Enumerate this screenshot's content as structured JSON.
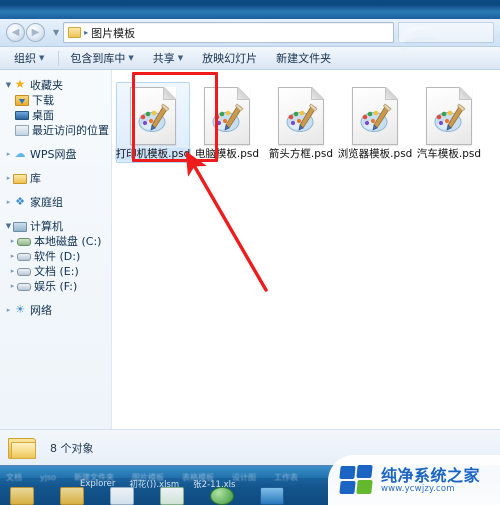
{
  "window": {
    "address": {
      "back_icon": "back-arrow-icon",
      "forward_icon": "forward-arrow-icon",
      "recent_icon": "chevron-down-icon",
      "folder_icon": "folder-icon",
      "separator": "▸",
      "crumb": "图片模板",
      "search_placeholder": ""
    },
    "toolbar": {
      "items": [
        {
          "label": "组织",
          "caret": "▼"
        },
        {
          "label": "包含到库中",
          "caret": "▼"
        },
        {
          "label": "共享",
          "caret": "▼"
        },
        {
          "label": "放映幻灯片",
          "caret": ""
        },
        {
          "label": "新建文件夹",
          "caret": ""
        }
      ]
    },
    "navigation": {
      "items": [
        {
          "label": "收藏夹",
          "icon": "star-icon",
          "twisty": "▼",
          "level": 0,
          "spaced": false
        },
        {
          "label": "下载",
          "icon": "downloads-icon",
          "twisty": "",
          "level": 1,
          "spaced": false
        },
        {
          "label": "桌面",
          "icon": "desktop-icon",
          "twisty": "",
          "level": 1,
          "spaced": false
        },
        {
          "label": "最近访问的位置",
          "icon": "recent-places-icon",
          "twisty": "",
          "level": 1,
          "spaced": false
        },
        {
          "label": "WPS网盘",
          "icon": "cloud-icon",
          "twisty": "▸",
          "level": 0,
          "spaced": true
        },
        {
          "label": "库",
          "icon": "library-icon",
          "twisty": "▸",
          "level": 0,
          "spaced": true
        },
        {
          "label": "家庭组",
          "icon": "homegroup-icon",
          "twisty": "▸",
          "level": 0,
          "spaced": true
        },
        {
          "label": "计算机",
          "icon": "computer-icon",
          "twisty": "▼",
          "level": 0,
          "spaced": true
        },
        {
          "label": "本地磁盘 (C:)",
          "icon": "system-drive-icon",
          "twisty": "▸",
          "level": 1,
          "spaced": false
        },
        {
          "label": "软件 (D:)",
          "icon": "drive-icon",
          "twisty": "▸",
          "level": 1,
          "spaced": false
        },
        {
          "label": "文档 (E:)",
          "icon": "drive-icon",
          "twisty": "▸",
          "level": 1,
          "spaced": false
        },
        {
          "label": "娱乐 (F:)",
          "icon": "drive-icon",
          "twisty": "▸",
          "level": 1,
          "spaced": false
        },
        {
          "label": "网络",
          "icon": "network-icon",
          "twisty": "▸",
          "level": 0,
          "spaced": true
        }
      ]
    },
    "files": [
      {
        "name": "打印机模板.psd",
        "icon": "psd-file-icon",
        "selected": true
      },
      {
        "name": "电脑模板.psd",
        "icon": "psd-file-icon",
        "selected": false
      },
      {
        "name": "箭头方框.psd",
        "icon": "psd-file-icon",
        "selected": false
      },
      {
        "name": "浏览器模板.psd",
        "icon": "psd-file-icon",
        "selected": false
      },
      {
        "name": "汽车模板.psd",
        "icon": "psd-file-icon",
        "selected": false
      }
    ],
    "status": {
      "folder_icon": "folder-icon",
      "text": "8 个对象"
    }
  },
  "annotations": {
    "highlight_box_color": "#ee1c1c",
    "arrow_color": "#ee1c1c"
  },
  "taskbar": {
    "labels_top": [
      "文档",
      "yjso",
      "新建文件夹",
      "图片模板",
      "表格模板",
      "设计图",
      "工作表"
    ],
    "labels_bottom": [
      "Explorer",
      "初花()).xlsm",
      "张2-11.xls"
    ]
  },
  "watermark": {
    "title": "纯净系统之家",
    "url": "www.ycwjzy.com",
    "logo_blue": "#1b64c4",
    "logo_green": "#63b82e"
  }
}
